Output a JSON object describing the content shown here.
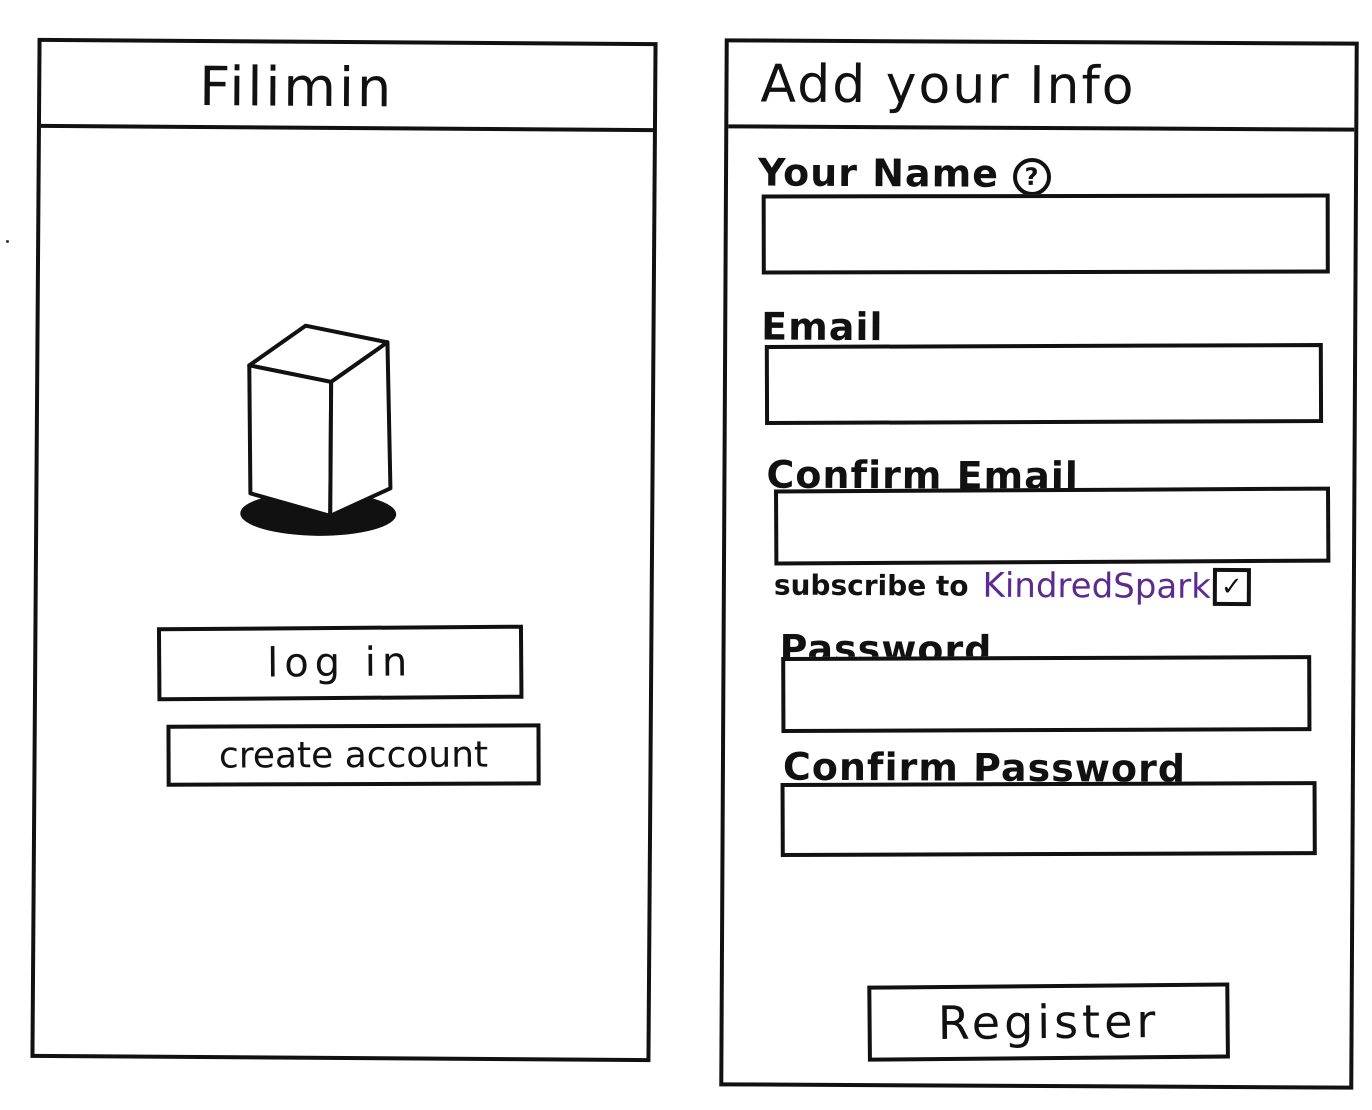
{
  "login_screen": {
    "title": "Filimin",
    "logo_icon": "cube-icon",
    "login_label": "log in",
    "create_account_label": "create account"
  },
  "register_screen": {
    "title": "Add your Info",
    "fields": {
      "name_label": "Your Name",
      "email_label": "Email",
      "confirm_email_label": "Confirm Email",
      "password_label": "Password",
      "confirm_password_label": "Confirm Password"
    },
    "help_icon": "question-circle-icon",
    "help_glyph": "?",
    "subscribe": {
      "prefix": "subscribe to",
      "brand": "KindredSpark",
      "checked": true,
      "check_glyph": "✓"
    },
    "register_label": "Register"
  },
  "colors": {
    "ink": "#111111",
    "brand_purple": "#5b2b8f",
    "background": "#ffffff"
  }
}
